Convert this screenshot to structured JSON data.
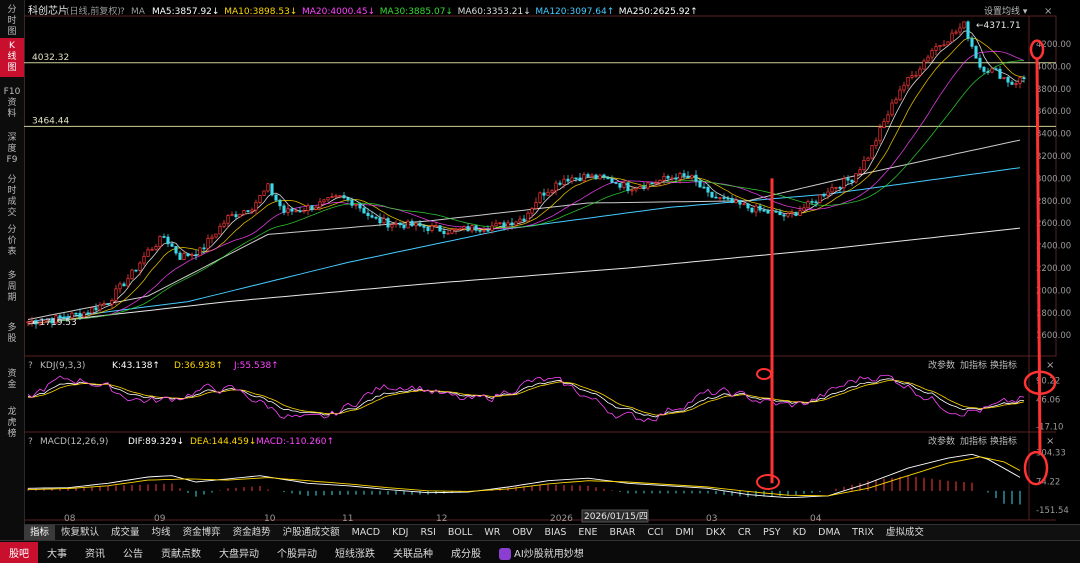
{
  "sidebar": {
    "items": [
      {
        "label": "分\n时\n图",
        "active": false
      },
      {
        "label": "K\n线\n图",
        "active": true
      },
      {
        "label": "F10\n资\n料",
        "active": false
      },
      {
        "label": "深\n度\nF9",
        "active": false
      },
      {
        "label": "分\n时\n成\n交",
        "active": false
      },
      {
        "label": "分\n价\n表",
        "active": false
      },
      {
        "label": "多\n周\n期",
        "active": false
      },
      {
        "label": "多\n股",
        "active": false
      },
      {
        "label": "资\n金",
        "active": false
      },
      {
        "label": "龙\n虎\n榜",
        "active": false
      }
    ]
  },
  "header": {
    "symbol": "科创芯片",
    "period": "(日线,前复权)",
    "help": "?",
    "ma_label": "MA",
    "ma_values": [
      {
        "text": "MA5:3857.92↓",
        "color": "#ffffff"
      },
      {
        "text": "MA10:3898.53↓",
        "color": "#ffd700"
      },
      {
        "text": "MA20:4000.45↓",
        "color": "#ff44ff"
      },
      {
        "text": "MA30:3885.07↓",
        "color": "#33dd33"
      },
      {
        "text": "MA60:3353.21↓",
        "color": "#dddddd"
      },
      {
        "text": "MA120:3097.64↑",
        "color": "#44ccff"
      },
      {
        "text": "MA250:2625.92↑",
        "color": "#ffffff"
      }
    ],
    "settings": "设置均线 ▾"
  },
  "kdj": {
    "title": "KDJ(9,3,3)",
    "k": "K:43.138↑",
    "d": "D:36.938↑",
    "j": "J:55.538↑",
    "btn_param": "改参数",
    "btn_add": "加指标",
    "btn_switch": "换指标"
  },
  "macd": {
    "title": "MACD(12,26,9)",
    "dif": "DIF:89.329↓",
    "dea": "DEA:144.459↓",
    "macd": "MACD:-110.260↑",
    "btn_param": "改参数",
    "btn_add": "加指标",
    "btn_switch": "换指标"
  },
  "time_cursor": "2026/01/15/四",
  "chart_data": {
    "type": "candlestick",
    "price_ticks": [
      "4200.00",
      "4000.00",
      "3800.00",
      "3600.00",
      "3400.00",
      "3200.00",
      "3000.00",
      "2800.00",
      "2600.00",
      "2400.00",
      "2200.00",
      "2000.00",
      "1800.00",
      "1600.00"
    ],
    "ylim": [
      1450,
      4450
    ],
    "hlines": [
      {
        "label": "4032.32",
        "value": 4032.32
      },
      {
        "label": "3464.44",
        "value": 3464.44
      }
    ],
    "annotations": [
      {
        "text": "4371.71",
        "value": 4371.71
      },
      {
        "text": "1719.53",
        "value": 1719.53
      }
    ],
    "x_labels": [
      "08",
      "09",
      "10",
      "11",
      "12",
      "2026",
      "03",
      "04"
    ],
    "trend": [
      [
        0,
        1720
      ],
      [
        6,
        1740
      ],
      [
        14,
        1800
      ],
      [
        20,
        1900
      ],
      [
        26,
        2150
      ],
      [
        30,
        2350
      ],
      [
        34,
        2480
      ],
      [
        38,
        2300
      ],
      [
        43,
        2350
      ],
      [
        50,
        2650
      ],
      [
        56,
        2750
      ],
      [
        60,
        2920
      ],
      [
        64,
        2700
      ],
      [
        68,
        2720
      ],
      [
        72,
        2760
      ],
      [
        78,
        2830
      ],
      [
        82,
        2780
      ],
      [
        86,
        2640
      ],
      [
        90,
        2600
      ],
      [
        96,
        2580
      ],
      [
        100,
        2560
      ],
      [
        106,
        2530
      ],
      [
        112,
        2560
      ],
      [
        118,
        2580
      ],
      [
        124,
        2650
      ],
      [
        128,
        2850
      ],
      [
        134,
        3000
      ],
      [
        140,
        3020
      ],
      [
        146,
        2980
      ],
      [
        150,
        2920
      ],
      [
        156,
        2960
      ],
      [
        162,
        3020
      ],
      [
        166,
        3000
      ],
      [
        170,
        2850
      ],
      [
        176,
        2780
      ],
      [
        182,
        2720
      ],
      [
        186,
        2690
      ],
      [
        190,
        2660
      ],
      [
        196,
        2780
      ],
      [
        200,
        2900
      ],
      [
        206,
        3000
      ],
      [
        210,
        3200
      ],
      [
        214,
        3500
      ],
      [
        218,
        3800
      ],
      [
        222,
        3950
      ],
      [
        226,
        4150
      ],
      [
        230,
        4250
      ],
      [
        234,
        4370
      ],
      [
        238,
        4000
      ],
      [
        242,
        3950
      ],
      [
        246,
        3850
      ],
      [
        249,
        3900
      ]
    ],
    "ma250": [
      [
        0,
        1700
      ],
      [
        50,
        1900
      ],
      [
        100,
        2060
      ],
      [
        150,
        2200
      ],
      [
        200,
        2370
      ],
      [
        249,
        2560
      ]
    ],
    "ma120": [
      [
        0,
        1720
      ],
      [
        40,
        1900
      ],
      [
        80,
        2250
      ],
      [
        120,
        2550
      ],
      [
        160,
        2740
      ],
      [
        200,
        2860
      ],
      [
        249,
        3100
      ]
    ],
    "ma60": [
      [
        0,
        1740
      ],
      [
        30,
        1950
      ],
      [
        60,
        2500
      ],
      [
        100,
        2620
      ],
      [
        140,
        2780
      ],
      [
        180,
        2800
      ],
      [
        210,
        3050
      ],
      [
        249,
        3350
      ]
    ],
    "price_circle_value": 4150,
    "kdj_ticks": [
      "90.22",
      "46.06",
      "-17.10"
    ],
    "macd_ticks": [
      "304.33",
      "74.22",
      "-151.54"
    ],
    "kdj_ylim": [
      -30,
      110
    ],
    "macd_ylim": [
      -200,
      340
    ],
    "dif": [
      [
        0,
        20
      ],
      [
        10,
        25
      ],
      [
        20,
        60
      ],
      [
        30,
        110
      ],
      [
        36,
        120
      ],
      [
        42,
        70
      ],
      [
        50,
        95
      ],
      [
        58,
        120
      ],
      [
        64,
        90
      ],
      [
        70,
        60
      ],
      [
        80,
        40
      ],
      [
        90,
        10
      ],
      [
        100,
        -15
      ],
      [
        110,
        -10
      ],
      [
        120,
        30
      ],
      [
        130,
        80
      ],
      [
        140,
        100
      ],
      [
        150,
        60
      ],
      [
        160,
        40
      ],
      [
        170,
        20
      ],
      [
        180,
        -30
      ],
      [
        190,
        -55
      ],
      [
        200,
        -40
      ],
      [
        210,
        60
      ],
      [
        220,
        180
      ],
      [
        230,
        260
      ],
      [
        236,
        290
      ],
      [
        240,
        250
      ],
      [
        249,
        89
      ]
    ],
    "dea": [
      [
        0,
        10
      ],
      [
        10,
        18
      ],
      [
        20,
        40
      ],
      [
        30,
        85
      ],
      [
        40,
        95
      ],
      [
        50,
        85
      ],
      [
        60,
        105
      ],
      [
        70,
        80
      ],
      [
        80,
        55
      ],
      [
        90,
        25
      ],
      [
        100,
        0
      ],
      [
        110,
        -5
      ],
      [
        120,
        15
      ],
      [
        130,
        55
      ],
      [
        140,
        80
      ],
      [
        150,
        70
      ],
      [
        160,
        50
      ],
      [
        170,
        30
      ],
      [
        180,
        -5
      ],
      [
        190,
        -35
      ],
      [
        200,
        -40
      ],
      [
        210,
        20
      ],
      [
        220,
        120
      ],
      [
        230,
        220
      ],
      [
        238,
        270
      ],
      [
        244,
        230
      ],
      [
        249,
        144
      ]
    ]
  },
  "bottom_tabs": [
    "指标",
    "恢复默认",
    "成交量",
    "均线",
    "资金博弈",
    "资金趋势",
    "沪股通成交额",
    "MACD",
    "KDJ",
    "RSI",
    "BOLL",
    "WR",
    "OBV",
    "BIAS",
    "ENE",
    "BRAR",
    "CCI",
    "DMI",
    "DKX",
    "CR",
    "PSY",
    "KD",
    "DMA",
    "TRIX",
    "虚拟成交"
  ],
  "footer_tabs": [
    "股吧",
    "大事",
    "资讯",
    "公告",
    "贡献点数",
    "大盘异动",
    "个股异动",
    "短线涨跌",
    "关联品种",
    "成分股"
  ],
  "footer_ai": "AI炒股就用妙想"
}
